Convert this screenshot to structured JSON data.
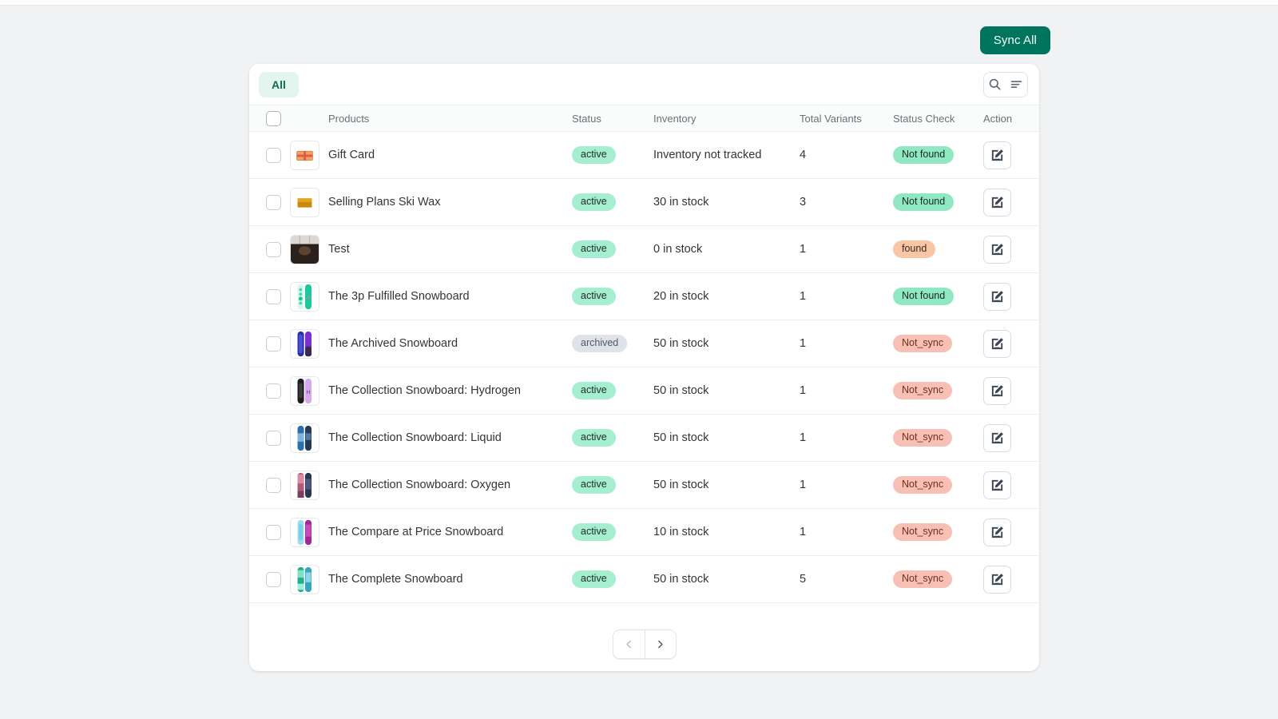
{
  "topbar": {
    "sync_all_label": "Sync All"
  },
  "card": {
    "tab_all_label": "All",
    "search_icon": "search-icon",
    "filter_icon": "filter-sort-icon"
  },
  "table": {
    "headers": {
      "products": "Products",
      "status": "Status",
      "inventory": "Inventory",
      "total_variants": "Total Variants",
      "status_check": "Status Check",
      "action": "Action"
    },
    "rows": [
      {
        "name": "Gift Card",
        "status": "active",
        "inventory": "Inventory not tracked",
        "variants": "4",
        "check": "Not found",
        "check_kind": "notfound",
        "thumb": "gift-card-thumbnail"
      },
      {
        "name": "Selling Plans Ski Wax",
        "status": "active",
        "inventory": "30 in stock",
        "variants": "3",
        "check": "Not found",
        "check_kind": "notfound",
        "thumb": "ski-wax-thumbnail"
      },
      {
        "name": "Test",
        "status": "active",
        "inventory": "0 in stock",
        "variants": "1",
        "check": "found",
        "check_kind": "found",
        "thumb": "dark-photo-thumbnail"
      },
      {
        "name": "The 3p Fulfilled Snowboard",
        "status": "active",
        "inventory": "20 in stock",
        "variants": "1",
        "check": "Not found",
        "check_kind": "notfound",
        "thumb": "teal-snowboard-thumbnail"
      },
      {
        "name": "The Archived Snowboard",
        "status": "archived",
        "inventory": "50 in stock",
        "variants": "1",
        "check": "Not_sync",
        "check_kind": "notsync",
        "thumb": "blue-purple-snowboard-thumbnail"
      },
      {
        "name": "The Collection Snowboard: Hydrogen",
        "status": "active",
        "inventory": "50 in stock",
        "variants": "1",
        "check": "Not_sync",
        "check_kind": "notsync",
        "thumb": "black-lilac-snowboard-thumbnail"
      },
      {
        "name": "The Collection Snowboard: Liquid",
        "status": "active",
        "inventory": "50 in stock",
        "variants": "1",
        "check": "Not_sync",
        "check_kind": "notsync",
        "thumb": "blue-snowboard-thumbnail"
      },
      {
        "name": "The Collection Snowboard: Oxygen",
        "status": "active",
        "inventory": "50 in stock",
        "variants": "1",
        "check": "Not_sync",
        "check_kind": "notsync",
        "thumb": "pink-navy-snowboard-thumbnail"
      },
      {
        "name": "The Compare at Price Snowboard",
        "status": "active",
        "inventory": "10 in stock",
        "variants": "1",
        "check": "Not_sync",
        "check_kind": "notsync",
        "thumb": "cyan-magenta-snowboard-thumbnail"
      },
      {
        "name": "The Complete Snowboard",
        "status": "active",
        "inventory": "50 in stock",
        "variants": "5",
        "check": "Not_sync",
        "check_kind": "notsync",
        "thumb": "green-teal-snowboard-thumbnail"
      }
    ],
    "action_icon": "edit-square-icon"
  },
  "pagination": {
    "prev_icon": "chevron-left-icon",
    "next_icon": "chevron-right-icon"
  },
  "colors": {
    "page_background": "#f1f2f4",
    "accent_green": "#00755e",
    "tab_active_bg": "#e3f5ed",
    "badge_active": "#a6eed0",
    "badge_archived": "#dfe3e8",
    "badge_not_found": "#8fe8c1",
    "badge_found": "#f7c7a5",
    "badge_not_sync": "#f8bfb4"
  }
}
